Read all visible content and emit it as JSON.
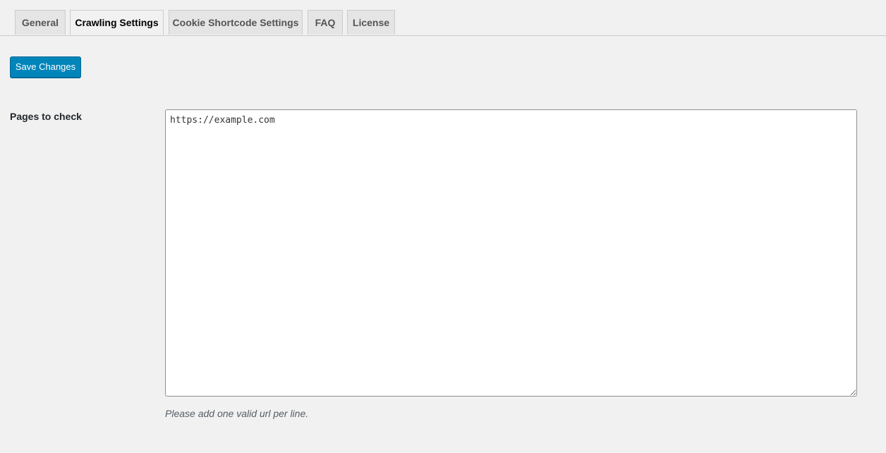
{
  "tabs": [
    {
      "label": "General",
      "active": false
    },
    {
      "label": "Crawling Settings",
      "active": true
    },
    {
      "label": "Cookie Shortcode Settings",
      "active": false
    },
    {
      "label": "FAQ",
      "active": false
    },
    {
      "label": "License",
      "active": false
    }
  ],
  "toolbar": {
    "save_label": "Save Changes"
  },
  "form": {
    "pages_label": "Pages to check",
    "pages_value": "https://example.com",
    "pages_description": "Please add one valid url per line."
  },
  "colors": {
    "primary_button": "#0085ba",
    "background": "#f1f1f1"
  }
}
